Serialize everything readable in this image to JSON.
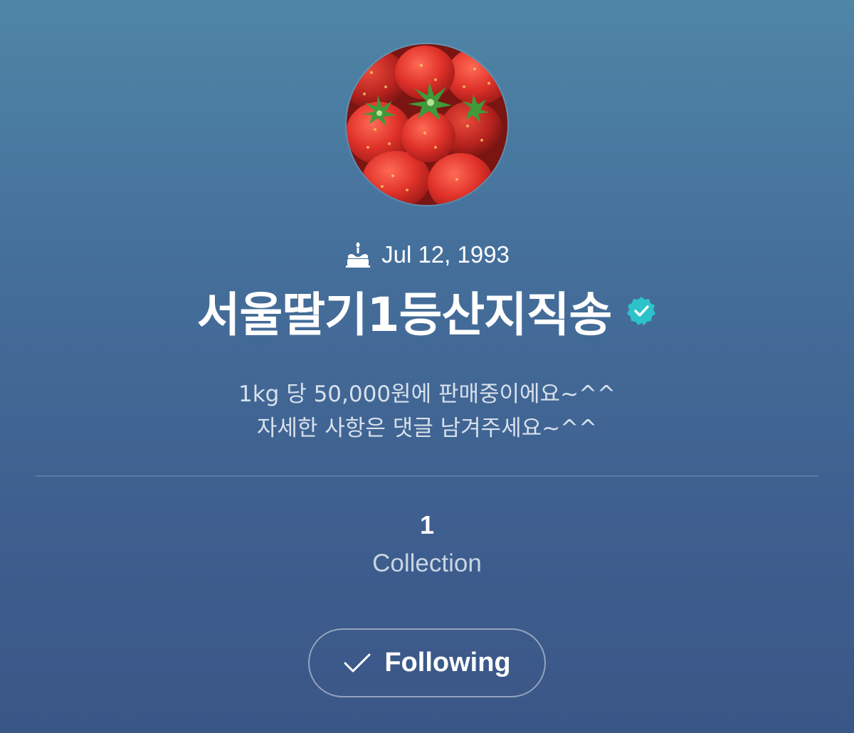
{
  "profile": {
    "avatar_icon": "strawberries-photo",
    "birthday": "Jul 12, 1993",
    "birthday_icon": "cake-icon",
    "name": "서울딸기1등산지직송",
    "verified_icon": "verified-badge-icon",
    "verified_color": "#2bc3c9",
    "bio_line1": "1kg 당 50,000원에 판매중이에요~^^",
    "bio_line2": "자세한 사항은 댓글 남겨주세요~^^"
  },
  "stats": {
    "collection_count": "1",
    "collection_label": "Collection"
  },
  "follow_button": {
    "icon": "check-icon",
    "label": "Following"
  }
}
